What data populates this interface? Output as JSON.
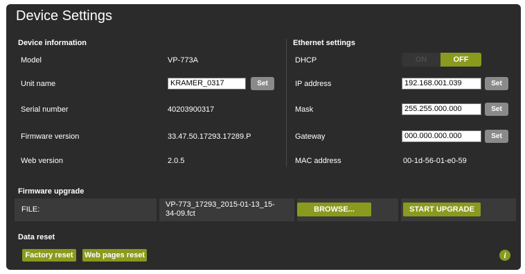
{
  "page": {
    "title": "Device Settings"
  },
  "device_info": {
    "heading": "Device information",
    "rows": [
      {
        "label": "Model",
        "value": "VP-773A"
      },
      {
        "label": "Unit name",
        "value": "KRAMER_0317"
      },
      {
        "label": "Serial number",
        "value": "40203900317"
      },
      {
        "label": "Firmware version",
        "value": "33.47.50.17293.17289.P"
      },
      {
        "label": "Web version",
        "value": "2.0.5"
      }
    ],
    "set_label": "Set"
  },
  "ethernet": {
    "heading": "Ethernet settings",
    "dhcp_label": "DHCP",
    "dhcp_on": "ON",
    "dhcp_off": "OFF",
    "dhcp_state": "OFF",
    "ip_label": "IP address",
    "ip_value": "192.168.001.039",
    "mask_label": "Mask",
    "mask_value": "255.255.000.000",
    "gateway_label": "Gateway",
    "gateway_value": "000.000.000.000",
    "mac_label": "MAC address",
    "mac_value": "00-1d-56-01-e0-59",
    "set_label": "Set"
  },
  "firmware_upgrade": {
    "heading": "Firmware upgrade",
    "file_label": "FILE:",
    "file_name_line1": "VP-773_17293_2015-01-13_15-",
    "file_name_line2": "34-09.fct",
    "browse_label": "BROWSE...",
    "start_label": "START UPGRADE"
  },
  "data_reset": {
    "heading": "Data reset",
    "factory_label": "Factory reset",
    "web_label": "Web pages reset"
  },
  "colors": {
    "panel": "#2b2b2b",
    "accent": "#8a9a1e",
    "set_button": "#8a8a8a"
  },
  "icons": {
    "info": "info-icon"
  }
}
